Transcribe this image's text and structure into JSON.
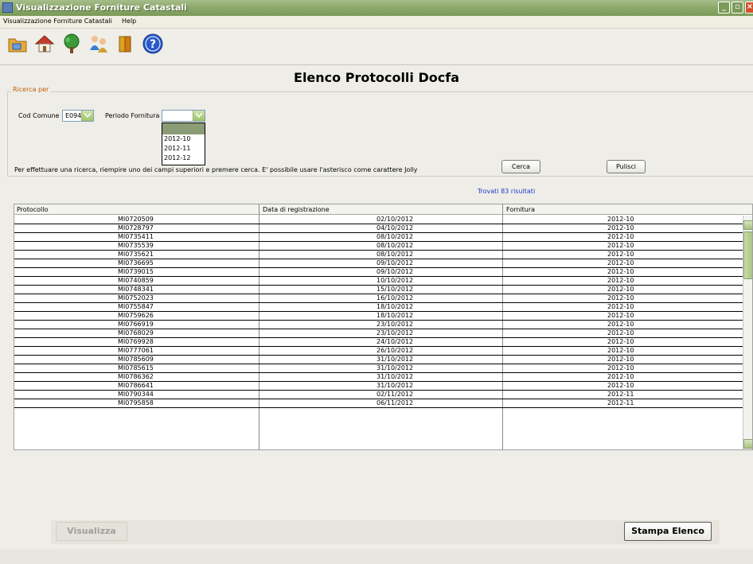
{
  "window": {
    "title": "Visualizzazione Forniture Catastali"
  },
  "menu": {
    "items": [
      "Visualizzazione Forniture Catastali",
      "Help"
    ]
  },
  "toolbar": {
    "icons": [
      "folder-icon",
      "house-icon",
      "tree-icon",
      "people-icon",
      "books-icon",
      "help-icon"
    ]
  },
  "page": {
    "heading": "Elenco Protocolli Docfa"
  },
  "search": {
    "legend": "Ricerca per",
    "cod_comune_label": "Cod Comune",
    "cod_comune_value": "E094",
    "periodo_label": "Periodo Fornitura",
    "periodo_value": "",
    "periodo_options": [
      "",
      "2012-10",
      "2012-11",
      "2012-12"
    ],
    "hint": "Per effettuare una ricerca, riempire uno dei campi superiori e premere cerca. E' possibile usare l'asterisco come carattere Jolly",
    "cerca_label": "Cerca",
    "pulisci_label": "Pulisci"
  },
  "results": {
    "count_text": "Trovati 83 risultati"
  },
  "table": {
    "headers": [
      "Protocollo",
      "Data di registrazione",
      "Fornitura"
    ],
    "rows": [
      [
        "MI0720509",
        "02/10/2012",
        "2012-10"
      ],
      [
        "MI0728797",
        "04/10/2012",
        "2012-10"
      ],
      [
        "MI0735411",
        "08/10/2012",
        "2012-10"
      ],
      [
        "MI0735539",
        "08/10/2012",
        "2012-10"
      ],
      [
        "MI0735621",
        "08/10/2012",
        "2012-10"
      ],
      [
        "MI0736695",
        "09/10/2012",
        "2012-10"
      ],
      [
        "MI0739015",
        "09/10/2012",
        "2012-10"
      ],
      [
        "MI0740859",
        "10/10/2012",
        "2012-10"
      ],
      [
        "MI0748341",
        "15/10/2012",
        "2012-10"
      ],
      [
        "MI0752023",
        "16/10/2012",
        "2012-10"
      ],
      [
        "MI0755847",
        "18/10/2012",
        "2012-10"
      ],
      [
        "MI0759626",
        "18/10/2012",
        "2012-10"
      ],
      [
        "MI0766919",
        "23/10/2012",
        "2012-10"
      ],
      [
        "MI0768029",
        "23/10/2012",
        "2012-10"
      ],
      [
        "MI0769928",
        "24/10/2012",
        "2012-10"
      ],
      [
        "MI0777061",
        "26/10/2012",
        "2012-10"
      ],
      [
        "MI0785609",
        "31/10/2012",
        "2012-10"
      ],
      [
        "MI0785615",
        "31/10/2012",
        "2012-10"
      ],
      [
        "MI0786362",
        "31/10/2012",
        "2012-10"
      ],
      [
        "MI0786641",
        "31/10/2012",
        "2012-10"
      ],
      [
        "MI0790344",
        "02/11/2012",
        "2012-11"
      ],
      [
        "MI0795858",
        "06/11/2012",
        "2012-11"
      ]
    ]
  },
  "actions": {
    "visualizza_label": "Visualizza",
    "stampa_label": "Stampa Elenco"
  }
}
